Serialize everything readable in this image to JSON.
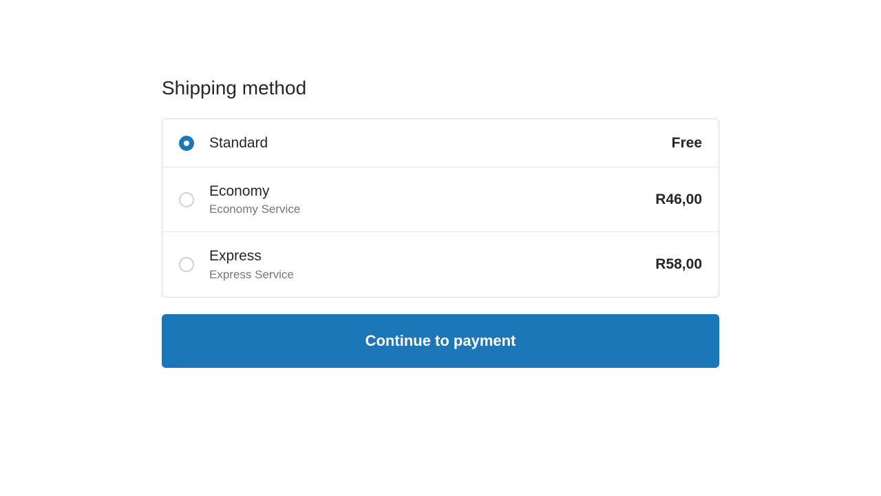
{
  "section_title": "Shipping method",
  "options": [
    {
      "label": "Standard",
      "sublabel": "",
      "price": "Free",
      "selected": true
    },
    {
      "label": "Economy",
      "sublabel": "Economy Service",
      "price": "R46,00",
      "selected": false
    },
    {
      "label": "Express",
      "sublabel": "Express Service",
      "price": "R58,00",
      "selected": false
    }
  ],
  "continue_label": "Continue to payment"
}
